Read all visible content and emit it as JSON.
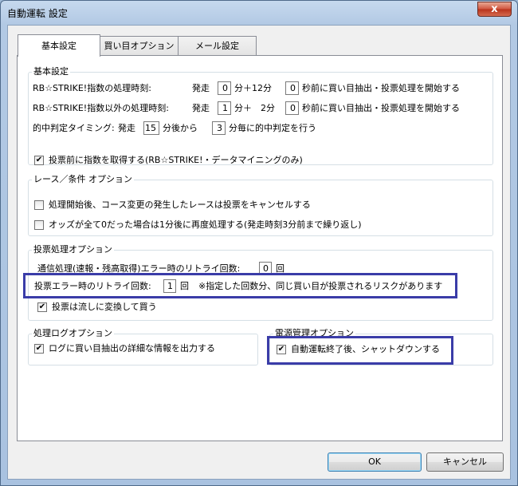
{
  "window": {
    "title": "自動運転 設定",
    "close_glyph": "x"
  },
  "tabs": [
    "基本設定",
    "買い目オプション",
    "メール設定"
  ],
  "basic": {
    "legend": "基本設定",
    "row1": {
      "label": "RB☆STRIKE!指数の処理時刻:",
      "pre": "発走",
      "min": "0",
      "mid": "分＋12分",
      "sec": "0",
      "post": "秒前に買い目抽出・投票処理を開始する"
    },
    "row2": {
      "label": "RB☆STRIKE!指数以外の処理時刻:",
      "pre": "発走",
      "min": "1",
      "mid": "分＋　2分",
      "sec": "0",
      "post": "秒前に買い目抽出・投票処理を開始する"
    },
    "row3": {
      "label": "的中判定タイミング:",
      "pre": "発走",
      "start": "15",
      "mid": "分後から",
      "interval": "3",
      "post": "分毎に的中判定を行う"
    },
    "checkbox": {
      "label": "投票前に指数を取得する(RB☆STRIKE!・データマイニングのみ)",
      "checked": "✔"
    }
  },
  "race": {
    "legend": "レース／条件 オプション",
    "opt1": "処理開始後、コース変更の発生したレースは投票をキャンセルする",
    "opt2": "オッズが全て0だった場合は1分後に再度処理する(発走時刻3分前まで繰り返し)"
  },
  "vote": {
    "legend": "投票処理オプション",
    "comm_label": "通信処理(速報・残高取得)エラー時のリトライ回数:",
    "comm_value": "0",
    "comm_unit": "回",
    "err_label": "投票エラー時のリトライ回数:",
    "err_value": "1",
    "err_unit": "回",
    "err_note": "※指定した回数分、同じ買い目が投票されるリスクがあります",
    "flow_label": "投票は流しに変換して買う",
    "flow_checked": "✔"
  },
  "log": {
    "legend": "処理ログオプション",
    "label": "ログに買い目抽出の詳細な情報を出力する",
    "checked": "✔"
  },
  "power": {
    "legend": "電源管理オプション",
    "label": "自動運転終了後、シャットダウンする",
    "checked": "✔"
  },
  "buttons": {
    "ok": "OK",
    "cancel": "キャンセル"
  }
}
